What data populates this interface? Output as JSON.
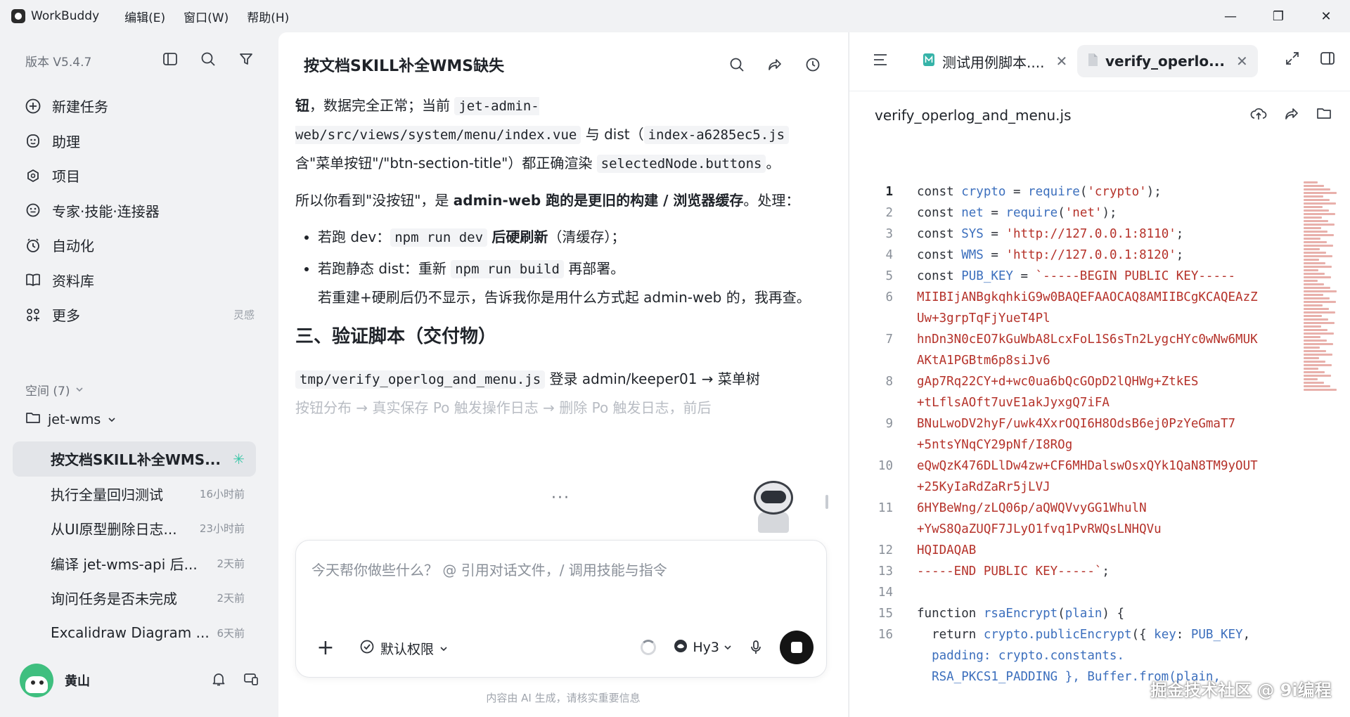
{
  "titlebar": {
    "app_name": "WorkBuddy",
    "menu": [
      "编辑(E)",
      "窗口(W)",
      "帮助(H)"
    ],
    "controls": [
      "—",
      "❐",
      "✕"
    ]
  },
  "sidebar": {
    "version": "版本 V5.4.7",
    "tools": [
      "sidebar-toggle-icon",
      "search-icon",
      "filter-icon"
    ],
    "nav": [
      {
        "label": "新建任务",
        "icon": "plus-circle-icon"
      },
      {
        "label": "助理",
        "icon": "assistant-icon"
      },
      {
        "label": "项目",
        "icon": "project-icon"
      },
      {
        "label": "专家·技能·连接器",
        "icon": "expert-icon"
      },
      {
        "label": "自动化",
        "icon": "clock-icon"
      },
      {
        "label": "资料库",
        "icon": "book-icon"
      },
      {
        "label": "更多",
        "icon": "grid-icon",
        "tag": "灵感"
      }
    ],
    "space_label": "空间 (7)",
    "project_label": "jet-wms",
    "tasks": [
      {
        "label": "按文档SKILL补全WMS...",
        "time": "",
        "active": true
      },
      {
        "label": "执行全量回归测试",
        "time": "16小时前"
      },
      {
        "label": "从UI原型删除日志...",
        "time": "23小时前"
      },
      {
        "label": "编译 jet-wms-api 后...",
        "time": "2天前"
      },
      {
        "label": "询问任务是否未完成",
        "time": "2天前"
      },
      {
        "label": "Excalidraw Diagram ...",
        "time": "6天前"
      }
    ],
    "user_name": "黄山"
  },
  "chat": {
    "title": "按文档SKILL补全WMS缺失",
    "para1": {
      "bold1": "钮",
      "t1": "，数据完全正常；当前 ",
      "code1": "jet-admin-web/src/views/system/menu/index.vue",
      "t2": " 与 dist（",
      "code2": "index-a6285ec5.js",
      "t3": " 含\"菜单按钮\"/\"btn-section-title\"）都正确渲染 ",
      "code3": "selectedNode.buttons",
      "t4": "。"
    },
    "para2": {
      "t1": "所以你看到\"没按钮\"，是 ",
      "bold1": "admin-web 跑的是更旧的构建 / 浏览器缓存",
      "t2": "。处理："
    },
    "bullet1": {
      "t1": "若跑 dev：",
      "code1": "npm run dev",
      "bold1": "后硬刷新",
      "t2": "（清缓存）；"
    },
    "bullet2": {
      "t1": "若跑静态 dist：重新 ",
      "code1": "npm run build",
      "t2": " 再部署。",
      "t3": "若重建+硬刷后仍不显示，告诉我你是用什么方式起 admin-web 的，我再查。"
    },
    "heading": "三、验证脚本（交付物）",
    "para3": {
      "code1": "tmp/verify_operlog_and_menu.js",
      "t1": " 登录 admin/keeper01 → 菜单树"
    },
    "fade_line": "按钮分布 → 真实保存 Po 触发操作日志 → 删除 Po 触发日志，前后",
    "input_placeholder": "今天帮你做些什么？ @ 引用对话文件，/ 调用技能与指令",
    "permission_label": "默认权限",
    "model_label": "Hy3",
    "disclaimer": "内容由 AI 生成，请核实重要信息"
  },
  "code_panel": {
    "tabs": [
      {
        "label": "测试用例脚本....",
        "active": false
      },
      {
        "label": "verify_operlo...",
        "active": true
      }
    ],
    "file_name": "verify_operlog_and_menu.js",
    "lines": [
      {
        "n": "1",
        "parts": [
          [
            "kw",
            "const "
          ],
          [
            "var",
            "crypto"
          ],
          [
            "kw",
            " = "
          ],
          [
            "fn",
            "require"
          ],
          [
            "kw",
            "("
          ],
          [
            "str",
            "'crypto'"
          ],
          [
            "kw",
            ");"
          ]
        ]
      },
      {
        "n": "2",
        "parts": [
          [
            "kw",
            "const "
          ],
          [
            "var",
            "net"
          ],
          [
            "kw",
            " = "
          ],
          [
            "fn",
            "require"
          ],
          [
            "kw",
            "("
          ],
          [
            "str",
            "'net'"
          ],
          [
            "kw",
            ");"
          ]
        ]
      },
      {
        "n": "3",
        "parts": [
          [
            "kw",
            "const "
          ],
          [
            "var",
            "SYS"
          ],
          [
            "kw",
            " = "
          ],
          [
            "str",
            "'http://127.0.0.1:8110'"
          ],
          [
            "kw",
            ";"
          ]
        ]
      },
      {
        "n": "4",
        "parts": [
          [
            "kw",
            "const "
          ],
          [
            "var",
            "WMS"
          ],
          [
            "kw",
            " = "
          ],
          [
            "str",
            "'http://127.0.0.1:8120'"
          ],
          [
            "kw",
            ";"
          ]
        ]
      },
      {
        "n": "5",
        "parts": [
          [
            "kw",
            "const "
          ],
          [
            "var",
            "PUB_KEY"
          ],
          [
            "kw",
            " = "
          ],
          [
            "str",
            "`-----BEGIN PUBLIC KEY-----"
          ]
        ]
      },
      {
        "n": "6",
        "parts": [
          [
            "str",
            "MIIBIjANBgkqhkiG9w0BAQEFAAOCAQ8AMIIBCgKCAQEAzZ"
          ]
        ],
        "cont": "Uw+3grpTqFjYueT4Pl"
      },
      {
        "n": "7",
        "parts": [
          [
            "str",
            "hnDn3N0cEO7kGuWbA8LcxFoL1S6sTn2LygcHYc0wNw6MUK"
          ]
        ],
        "cont": "AKtA1PGBtm6p8siJv6"
      },
      {
        "n": "8",
        "parts": [
          [
            "str",
            "gAp7Rq22CY+d+wc0ua6bQcGOpD2lQHWg+ZtkES"
          ]
        ],
        "cont": "+tLflsAOft7uvE1akJyxgQ7iFA"
      },
      {
        "n": "9",
        "parts": [
          [
            "str",
            "BNuLwoDV2hyF/uwk4XxrOQI6H8OdsB6ej0PzYeGmaT7"
          ]
        ],
        "cont": "+5ntsYNqCY29pNf/I8ROg"
      },
      {
        "n": "10",
        "parts": [
          [
            "str",
            "eQwQzK476DLlDw4zw+CF6MHDalswOsxQYk1QaN8TM9yOUT"
          ]
        ],
        "cont": "+25KyIaRdZaRr5jLVJ"
      },
      {
        "n": "11",
        "parts": [
          [
            "str",
            "6HYBeWng/zLQ06p/aQWQVvyGG1WhulN"
          ]
        ],
        "cont": "+YwS8QaZUQF7JLyO1fvq1PvRWQsLNHQVu"
      },
      {
        "n": "12",
        "parts": [
          [
            "str",
            "HQIDAQAB"
          ]
        ]
      },
      {
        "n": "13",
        "parts": [
          [
            "str",
            "-----END PUBLIC KEY-----`"
          ],
          [
            "kw",
            ";"
          ]
        ]
      },
      {
        "n": "14",
        "parts": []
      },
      {
        "n": "15",
        "parts": [
          [
            "kw",
            "function "
          ],
          [
            "fn",
            "rsaEncrypt"
          ],
          [
            "kw",
            "("
          ],
          [
            "var",
            "plain"
          ],
          [
            "kw",
            ") {"
          ]
        ]
      },
      {
        "n": "16",
        "parts": [
          [
            "kw",
            "  return "
          ],
          [
            "fn",
            "crypto.publicEncrypt"
          ],
          [
            "kw",
            "({ "
          ],
          [
            "var",
            "key"
          ],
          [
            "kw",
            ": "
          ],
          [
            "var",
            "PUB_KEY"
          ],
          [
            "kw",
            ","
          ]
        ],
        "cont": "  padding: crypto.constants.",
        "cont2": "  RSA_PKCS1_PADDING }, Buffer.from(plain,"
      }
    ]
  },
  "watermark": "掘金技术社区 @ 9i编程"
}
